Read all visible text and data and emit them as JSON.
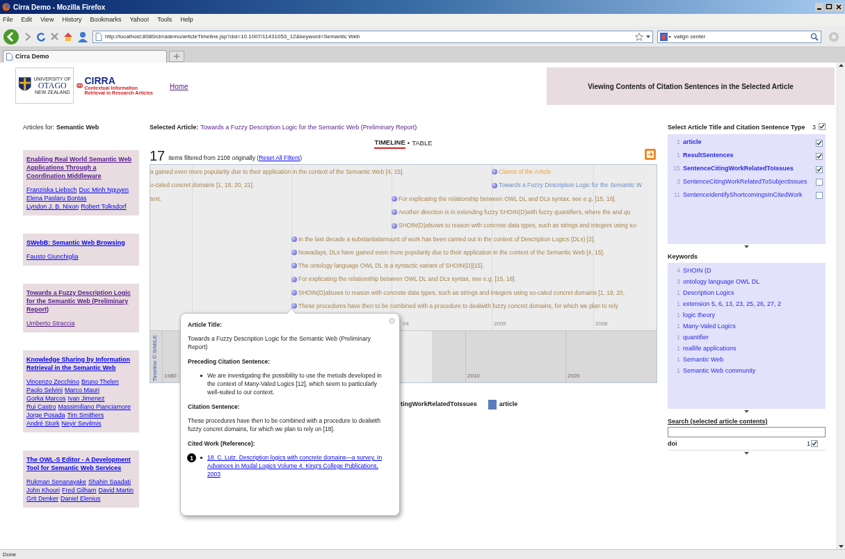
{
  "window": {
    "title": "Cirra Demo - Mozilla Firefox"
  },
  "menu": [
    "File",
    "Edit",
    "View",
    "History",
    "Bookmarks",
    "Yahoo!",
    "Tools",
    "Help"
  ],
  "address_bar": {
    "url": "http://localhost:8080/cirrademo/articleTimeline.jsp?doi=10.1007/11431053_12&keyword=Semantic Web"
  },
  "search_bar": {
    "value": "valign center"
  },
  "tabs": [
    {
      "label": "Cirra Demo",
      "selected": true
    }
  ],
  "header": {
    "otago_logo": [
      "UNIVERSITY OF",
      "OTAGO",
      "NEW ZEALAND"
    ],
    "cirra_logo": [
      "CIRRA",
      "Contextual Information",
      "Retrieval in Research Articles"
    ],
    "home_link": "Home",
    "banner": "Viewing Contents of Citation Sentences in the Selected Article"
  },
  "articles": {
    "label": "Articles for:",
    "keyword": "Semantic Web",
    "items": [
      {
        "title": "Enabling Real World Semantic Web Applications Through a Coordination Middleware",
        "visited": true,
        "authors": [
          {
            "name": "Franziska Liebsch",
            "visited": false
          },
          {
            "name": "Duc Minh Nguyen",
            "visited": false
          },
          {
            "name": "Elena Paslaru Bontas",
            "visited": false
          },
          {
            "name": "Lyndon J. B. Nixon",
            "visited": false
          },
          {
            "name": "Robert Tolksdorf",
            "visited": false
          }
        ]
      },
      {
        "title": "SWebB: Semantic Web Browsing",
        "visited": false,
        "authors": [
          {
            "name": "Fausto Giunchiglia",
            "visited": false
          }
        ]
      },
      {
        "title": "Towards a Fuzzy Description Logic for the Semantic Web (Preliminary Report)",
        "visited": true,
        "authors": [
          {
            "name": "Umberto Straccia",
            "visited": true
          }
        ]
      },
      {
        "title": "Knowledge Sharing by Information Retrieval in the Semantic Web",
        "visited": false,
        "authors": [
          {
            "name": "Vincenzo Zecchino",
            "visited": false
          },
          {
            "name": "Bruno Thelen",
            "visited": false
          },
          {
            "name": "Paolo Selvini",
            "visited": false
          },
          {
            "name": "Marco Mauri",
            "visited": false
          },
          {
            "name": "Gorka Marcos",
            "visited": false
          },
          {
            "name": "Ivan Jimenez",
            "visited": false
          },
          {
            "name": "Rui Castro",
            "visited": false
          },
          {
            "name": "Massimiliano Pianciamore",
            "visited": false
          },
          {
            "name": "Jorge Posada",
            "visited": false
          },
          {
            "name": "Tim Smithers",
            "visited": false
          },
          {
            "name": "André Stork",
            "visited": false
          },
          {
            "name": "Neyir Sevilmis",
            "visited": false
          }
        ]
      },
      {
        "title": "The OWL-S Editor - A Development Tool for Semantic Web Services",
        "visited": false,
        "authors": [
          {
            "name": "Rukman Senanayake",
            "visited": false
          },
          {
            "name": "Shahin Saadati",
            "visited": false
          },
          {
            "name": "John Khouri",
            "visited": false
          },
          {
            "name": "Fred Gilham",
            "visited": false
          },
          {
            "name": "David Martin",
            "visited": false
          },
          {
            "name": "Grit Denker",
            "visited": false
          },
          {
            "name": "Daniel Elenius",
            "visited": false
          }
        ]
      }
    ]
  },
  "selected_article": {
    "label": "Selected Article:",
    "title": "Towards a Fuzzy Description Logic for the Semantic Web (Preliminary Report)"
  },
  "views": [
    {
      "label": "TIMELINE",
      "selected": true
    },
    {
      "label": "TABLE",
      "selected": false
    }
  ],
  "view_separator": "•",
  "filter": {
    "count": "17",
    "text": "items filtered from 2108 originally (",
    "link": "Reset All Filters",
    "suffix": ")"
  },
  "timeline": {
    "events": [
      {
        "kind": "sentence",
        "cut": true,
        "text": "a gained even more popularity due to their application in the context of the Semantic Web [4, 15]."
      },
      {
        "kind": "claims",
        "cut": false,
        "text": "Claims of the Article"
      },
      {
        "kind": "sentence",
        "cut": true,
        "text": "o-caled concret domains [1, 18, 20, 21]."
      },
      {
        "kind": "article",
        "cut": false,
        "text": "Towards a Fuzzy Description Logic for the Semantic W"
      },
      {
        "kind": "sentence",
        "cut": true,
        "text": "text."
      },
      {
        "kind": "sentence",
        "cut": false,
        "text": "For explicating the relationship between OWL DL and DLs syntax, see e.g. [15, 16]."
      },
      {
        "kind": "sentence",
        "cut": false,
        "text": "Another direction is in extending fuzzy SHOIN(D)with fuzzy quantifiers, where the and qu"
      },
      {
        "kind": "sentence",
        "cut": false,
        "text": "SHOIN(D)alsows to reason with concrete data types, such as strings and integers using so-"
      },
      {
        "kind": "sentence",
        "cut": false,
        "text": "In the last decade a substantialamount of work has been carried out in the context of Description Logics (DLs) [2]."
      },
      {
        "kind": "sentence",
        "cut": false,
        "text": "Nowadays, DLs have gained even more popularity due to their application in the context of the Semantic Web [4, 15]."
      },
      {
        "kind": "sentence",
        "cut": false,
        "text": "The ontology language OWL DL is a syntactic variant of SHOIN(D)[15]."
      },
      {
        "kind": "sentence",
        "cut": false,
        "text": "For explicating the relationship between OWL DL and DLs syntax, see e.g. [15, 16]."
      },
      {
        "kind": "sentence",
        "cut": false,
        "text": "SHOIN(D)alsows to reason with concrete data types, such as strings and integers using so-caled concret domains [1, 18, 20,"
      },
      {
        "kind": "sentence",
        "cut": false,
        "text": "These procedures have then to be combined with a procedure to dealwith fuzzy concret domains, for which we plan to rely"
      }
    ],
    "upper_ticks": [
      "04",
      "2005",
      "2006"
    ],
    "lower_ticks": [
      "1980",
      "2010",
      "2020"
    ],
    "credit": "Timeline © SIMILE"
  },
  "popup": {
    "sections": [
      {
        "heading": "Article Title:",
        "kind": "text",
        "text": "Towards a Fuzzy Description Logic for the Semantic Web (Preliminary Report)"
      },
      {
        "heading": "Preceding Citation Sentence:",
        "kind": "bullet",
        "text": "We are investigating the possibility to use the metods developed in the context of Many-Valed Logics [12], which seem to particularly well-suited to our context."
      },
      {
        "heading": "Citation Sentence:",
        "kind": "text",
        "text": "These procedures have then to be combined with a procedure to dealwith fuzzy concret domains, for which we plan to rely on [18]."
      },
      {
        "heading": "Cited Work (Reference):",
        "kind": "link",
        "text": "18. C. Lutz. Description logics with concrete domains—a survey. In Advances in Modal Logics Volume 4. King's College Publications, 2003"
      }
    ],
    "callout": "1"
  },
  "legend": [
    {
      "label": "tingWorkRelatedToIssues"
    },
    {
      "label": "article",
      "color": "#5b7bc0"
    }
  ],
  "type_facet": {
    "title": "Select Article Title and Citation Sentence Type",
    "count": "3",
    "checked": true,
    "items": [
      {
        "count": "1",
        "label": "article",
        "checked": true
      },
      {
        "count": "1",
        "label": "ResultSentences",
        "checked": true
      },
      {
        "count": "15",
        "label": "SentenceCitingWorkRelatedToIssues",
        "checked": true
      },
      {
        "count": "3",
        "label": "SentenceCitingWorkRelatedToSubjectIssues",
        "checked": false
      },
      {
        "count": "11",
        "label": "SentenceIdentifyShortcomingsInCitedWork",
        "checked": false
      }
    ]
  },
  "keywords": {
    "title": "Keywords",
    "items": [
      {
        "count": "4",
        "label": "SHOIN (D"
      },
      {
        "count": "3",
        "label": "ontology language OWL DL"
      },
      {
        "count": "1",
        "label": "Description Logics"
      },
      {
        "count": "1",
        "label": "extension 5, 6, 13, 23, 25, 26, 27, 2"
      },
      {
        "count": "1",
        "label": "logic theory"
      },
      {
        "count": "1",
        "label": "Many-Valed Logics"
      },
      {
        "count": "1",
        "label": "quantifier"
      },
      {
        "count": "1",
        "label": "reallife applications"
      },
      {
        "count": "1",
        "label": "Semantic Web"
      },
      {
        "count": "1",
        "label": "Semantic Web community"
      }
    ]
  },
  "search_facet": {
    "title": "Search (selected article contents)",
    "results": [
      {
        "label": "doi",
        "count": "1",
        "checked": true
      }
    ]
  },
  "status_bar": "Done"
}
